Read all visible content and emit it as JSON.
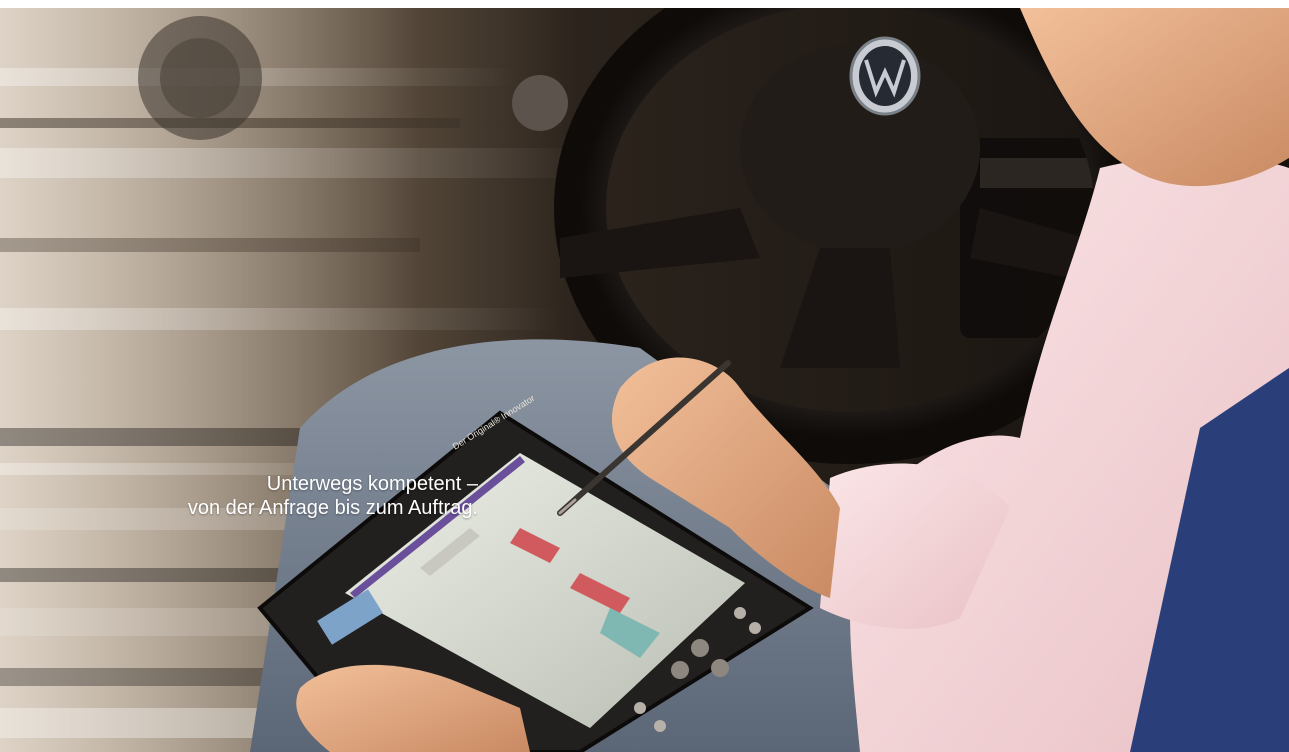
{
  "headline": {
    "line1": "Unterwegs kompetent –",
    "line2": "von der Anfrage bis zum Auftrag."
  },
  "device": {
    "brand_label": "Der Original® Innovator"
  },
  "colors": {
    "background": "#ffffff",
    "headline_text": "#ffffff",
    "interior_dark": "#1c1814",
    "shirt_pink": "#f3d3d6",
    "jeans_blue": "#6f7b8c",
    "screen_accent_red": "#d05a5e",
    "screen_accent_teal": "#7fb7b2",
    "door_blue": "#2a3f7a"
  },
  "icons": {
    "steering_wheel_emblem": "vw-logo-icon"
  }
}
